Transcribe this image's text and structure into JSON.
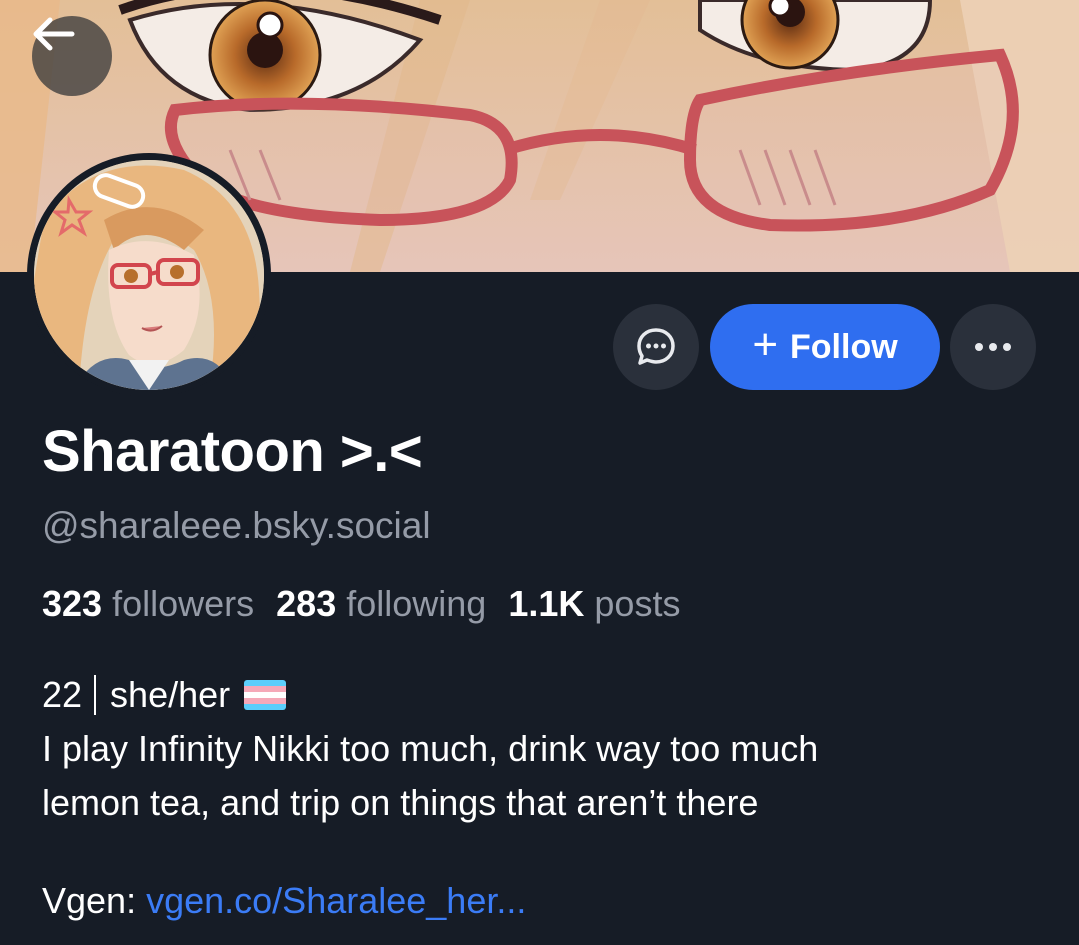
{
  "profile": {
    "display_name": "Sharatoon >.<",
    "handle": "@sharaleee.bsky.social",
    "followers_count": "323",
    "followers_label": "followers",
    "following_count": "283",
    "following_label": "following",
    "posts_count": "1.1K",
    "posts_label": "posts"
  },
  "actions": {
    "follow_label": "Follow",
    "back_icon": "arrow-left-icon",
    "message_icon": "chat-bubble-icon",
    "more_icon": "ellipsis-icon"
  },
  "bio": {
    "age": "22",
    "pronouns": "she/her",
    "flag_icon": "trans-flag-icon",
    "line2": "I play Infinity Nikki too much, drink way too much",
    "line3": "lemon tea, and trip on things that aren’t there",
    "vgen_label": "Vgen:",
    "vgen_link": "vgen.co/Sharalee_her..."
  },
  "colors": {
    "background": "#161c26",
    "accent": "#2f6ef0",
    "link": "#3b7cf6",
    "muted_text": "#959ba7",
    "button_bg": "#2a303b"
  }
}
